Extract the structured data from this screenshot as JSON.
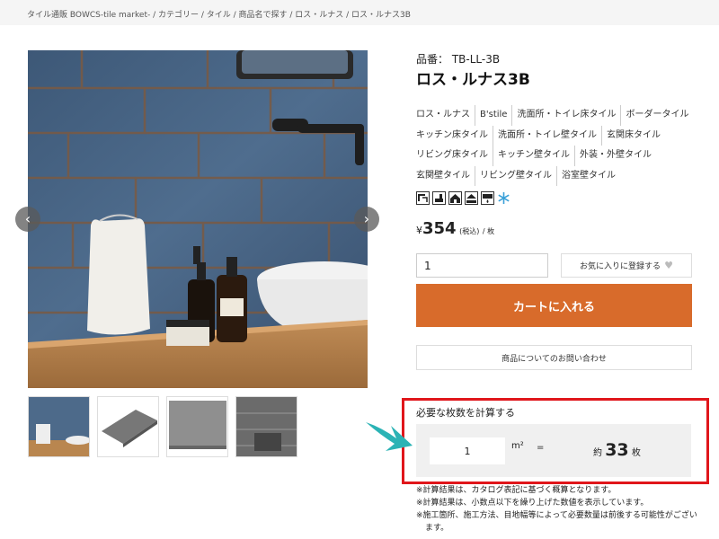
{
  "breadcrumb": "タイル通販 BOWCS-tile market- / カテゴリー / タイル / 商品名で探す / ロス・ルナス / ロス・ルナス3B",
  "product": {
    "code": "品番： TB-LL-3B",
    "name": "ロス・ルナス3B"
  },
  "tags": [
    "ロス・ルナス",
    "B'stile",
    "洗面所・トイレ床タイル",
    "ボーダータイル",
    "キッチン床タイル",
    "洗面所・トイレ壁タイル",
    "玄関床タイル",
    "リビング床タイル",
    "キッチン壁タイル",
    "外装・外壁タイル",
    "玄関壁タイル",
    "リビング壁タイル",
    "浴室壁タイル"
  ],
  "icons": [
    "interior-wall-icon",
    "interior-floor-icon",
    "exterior-wall-icon",
    "exterior-floor-icon",
    "water-use-icon",
    "frost-resistant-icon"
  ],
  "price": {
    "currency": "¥",
    "amount": "354",
    "tax": "(税込)",
    "per": "/ 枚"
  },
  "purchase": {
    "quantity": "1",
    "favorite_label": "お気に入りに登録する",
    "cart_label": "カートに入れる",
    "inquiry_label": "商品についてのお問い合わせ"
  },
  "calculator": {
    "title": "必要な枚数を計算する",
    "area_value": "1",
    "unit": "m²",
    "equals": "=",
    "result_prefix": "約",
    "result_value": "33",
    "result_suffix": "枚"
  },
  "notes": [
    "※計算結果は、カタログ表記に基づく概算となります。",
    "※計算結果は、小数点以下を繰り上げた数値を表示しています。",
    "※施工箇所、施工方法、目地幅等によって必要数量は前後する可能性がございます。"
  ],
  "colors": {
    "accent": "#d86b2b",
    "highlight_border": "#e0161b",
    "annotation_arrow": "#2bb3b5"
  }
}
